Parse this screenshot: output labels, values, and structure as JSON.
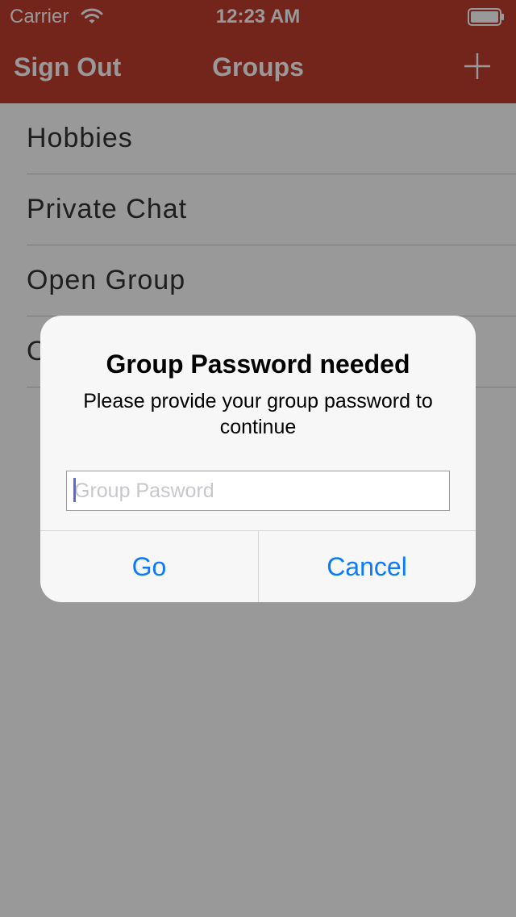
{
  "status_bar": {
    "carrier": "Carrier",
    "time": "12:23 AM",
    "wifi_icon": "wifi-icon",
    "battery_icon": "battery-icon"
  },
  "nav_bar": {
    "left_label": "Sign Out",
    "title": "Groups",
    "right_icon": "plus-icon",
    "color": "#c03c2d"
  },
  "groups": {
    "items": [
      {
        "label": "Hobbies"
      },
      {
        "label": "Private Chat"
      },
      {
        "label": "Open Group"
      },
      {
        "label": "O"
      }
    ]
  },
  "alert": {
    "title": "Group Password needed",
    "message": "Please provide your group password to continue",
    "input_placeholder": "Group Pasword",
    "input_value": "",
    "go_label": "Go",
    "cancel_label": "Cancel",
    "button_color": "#0a7aff"
  }
}
